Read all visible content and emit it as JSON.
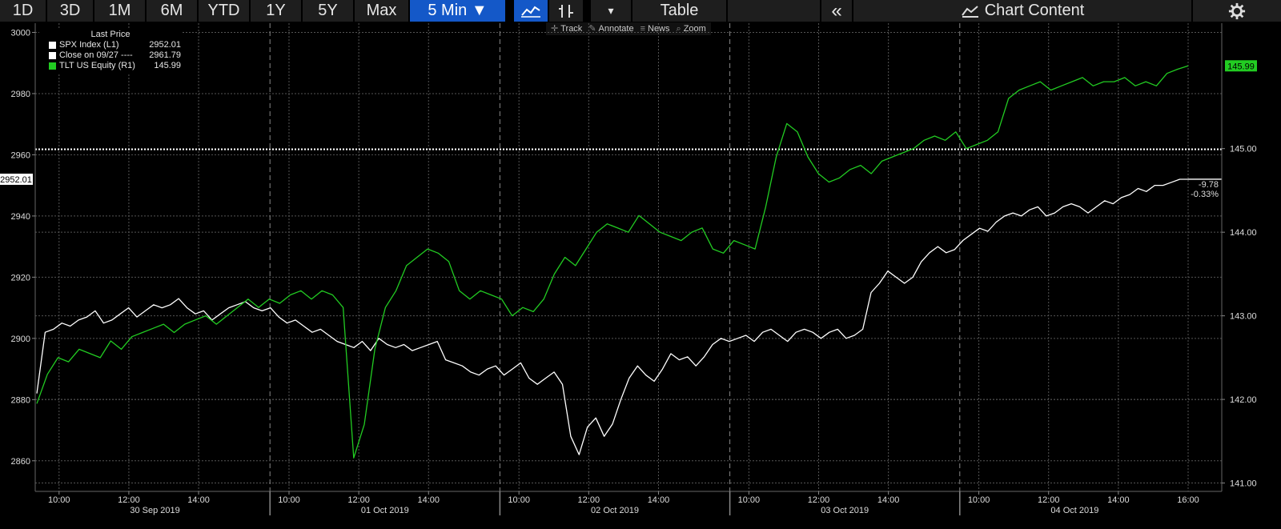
{
  "toolbar": {
    "ranges": [
      "1D",
      "3D",
      "1M",
      "6M",
      "YTD",
      "1Y",
      "5Y",
      "Max"
    ],
    "interval": "5 Min ▼",
    "line_icon": "line-chart-icon",
    "bar_icon": "bar-chart-icon",
    "dropdown": "▾",
    "table": "Table",
    "collapse": "«",
    "chart_content": "Chart Content",
    "settings_icon": "gear-icon"
  },
  "subtools": {
    "track": "Track",
    "annotate": "Annotate",
    "news": "News",
    "zoom": "Zoom"
  },
  "legend": {
    "header": "Last Price",
    "rows": [
      {
        "name": "SPX Index  (L1)",
        "value": "2952.01",
        "color": "#ffffff"
      },
      {
        "name": "Close on 09/27 ----",
        "value": "2961.79",
        "color": "#ffffff"
      },
      {
        "name": "TLT US Equity  (R1)",
        "value": "145.99",
        "color": "#22cc22"
      }
    ]
  },
  "chart_data": {
    "type": "line",
    "left_axis": {
      "ylim": [
        2850,
        3003
      ],
      "ticks": [
        2860,
        2880,
        2900,
        2920,
        2940,
        2960,
        2980,
        3000
      ]
    },
    "right_axis": {
      "ylim": [
        140.9,
        146.5
      ],
      "ticks": [
        "141.00",
        "142.00",
        "143.00",
        "144.00",
        "145.00"
      ]
    },
    "x_axis": {
      "time_ticks": [
        "10:00",
        "12:00",
        "14:00",
        "10:00",
        "12:00",
        "14:00",
        "10:00",
        "12:00",
        "14:00",
        "10:00",
        "12:00",
        "14:00",
        "10:00",
        "12:00",
        "14:00",
        "16:00"
      ],
      "dates": [
        "30 Sep 2019",
        "01 Oct 2019",
        "02 Oct 2019",
        "03 Oct 2019",
        "04 Oct 2019"
      ]
    },
    "reference_line": {
      "label": "Close on 09/27",
      "value": 2961.79
    },
    "series": [
      {
        "name": "SPX Index",
        "axis": "left",
        "color": "#ffffff",
        "values": [
          2882,
          2902,
          2903,
          2905,
          2904,
          2906,
          2907,
          2909,
          2905,
          2906,
          2908,
          2910,
          2907,
          2909,
          2911,
          2910,
          2911,
          2913,
          2910,
          2908,
          2909,
          2906,
          2908,
          2910,
          2911,
          2912,
          2910,
          2909,
          2910,
          2907,
          2905,
          2906,
          2904,
          2902,
          2903,
          2901,
          2899,
          2898,
          2897,
          2899,
          2896,
          2900,
          2898,
          2897,
          2898,
          2896,
          2897,
          2898,
          2899,
          2893,
          2892,
          2891,
          2889,
          2888,
          2890,
          2891,
          2888,
          2890,
          2892,
          2887,
          2885,
          2887,
          2889,
          2885,
          2868,
          2862,
          2871,
          2874,
          2868,
          2872,
          2880,
          2887,
          2891,
          2888,
          2886,
          2890,
          2895,
          2893,
          2894,
          2891,
          2894,
          2898,
          2900,
          2899,
          2900,
          2901,
          2899,
          2902,
          2903,
          2901,
          2899,
          2902,
          2903,
          2902,
          2900,
          2902,
          2903,
          2900,
          2901,
          2903,
          2915,
          2918,
          2922,
          2920,
          2918,
          2920,
          2925,
          2928,
          2930,
          2928,
          2929,
          2932,
          2934,
          2936,
          2935,
          2938,
          2940,
          2941,
          2940,
          2942,
          2943,
          2940,
          2941,
          2943,
          2944,
          2943,
          2941,
          2943,
          2945,
          2944,
          2946,
          2947,
          2949,
          2948,
          2950,
          2950,
          2951,
          2952,
          2952.01
        ],
        "note": "approximate 5-min closes traced from chart"
      },
      {
        "name": "TLT US Equity",
        "axis": "right",
        "color": "#22cc22",
        "values": [
          141.95,
          142.3,
          142.5,
          142.45,
          142.6,
          142.55,
          142.5,
          142.7,
          142.6,
          142.75,
          142.8,
          142.85,
          142.9,
          142.8,
          142.9,
          142.95,
          143.0,
          142.9,
          143.0,
          143.1,
          143.2,
          143.1,
          143.2,
          143.15,
          143.25,
          143.3,
          143.2,
          143.3,
          143.25,
          143.1,
          141.3,
          141.7,
          142.6,
          143.1,
          143.3,
          143.6,
          143.7,
          143.8,
          143.75,
          143.65,
          143.3,
          143.2,
          143.3,
          143.25,
          143.2,
          143.0,
          143.1,
          143.05,
          143.2,
          143.5,
          143.7,
          143.6,
          143.8,
          144.0,
          144.1,
          144.05,
          144.0,
          144.2,
          144.1,
          144.0,
          143.95,
          143.9,
          144.0,
          144.05,
          143.8,
          143.75,
          143.9,
          143.85,
          143.8,
          144.3,
          144.9,
          145.3,
          145.2,
          144.9,
          144.7,
          144.6,
          144.65,
          144.75,
          144.8,
          144.7,
          144.85,
          144.9,
          144.95,
          145.0,
          145.1,
          145.15,
          145.1,
          145.2,
          145.0,
          145.05,
          145.1,
          145.2,
          145.6,
          145.7,
          145.75,
          145.8,
          145.7,
          145.75,
          145.8,
          145.85,
          145.75,
          145.8,
          145.8,
          145.85,
          145.75,
          145.8,
          145.75,
          145.9,
          145.95,
          145.99
        ]
      }
    ],
    "last_labels": {
      "left": "2952.01",
      "right": "145.99",
      "change": "-9.78",
      "change_pct": "-0.33%"
    }
  }
}
